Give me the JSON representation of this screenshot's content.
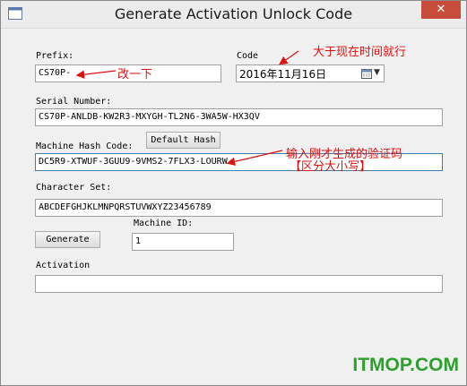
{
  "window": {
    "title": "Generate Activation Unlock Code",
    "close": "✕"
  },
  "labels": {
    "prefix": "Prefix:",
    "code": "Code",
    "serial": "Serial Number:",
    "machine_hash": "Machine Hash Code:",
    "charset": "Character Set:",
    "machine_id": "Machine ID:",
    "activation": "Activation"
  },
  "fields": {
    "prefix": "CS70P-",
    "date": "2016年11月16日",
    "serial": "CS70P-ANLDB-KW2R3-MXYGH-TL2N6-3WA5W-HX3QV",
    "machine_hash": "DC5R9-XTWUF-3GUU9-9VMS2-7FLX3-LOURW",
    "charset": "ABCDEFGHJKLMNPQRSTUVWXYZ23456789",
    "machine_id": "1",
    "activation": ""
  },
  "buttons": {
    "default_hash": "Default Hash",
    "generate": "Generate"
  },
  "annotations": {
    "change": "改一下",
    "code_note": "大于现在时间就行",
    "hash_note_1": "输入刚才生成的验证码",
    "hash_note_2": "【区分大小写】"
  },
  "watermark": "ITMOP.COM",
  "colors": {
    "annotation": "#e01010",
    "watermark": "#2ca02c",
    "close": "#c74c3c"
  }
}
